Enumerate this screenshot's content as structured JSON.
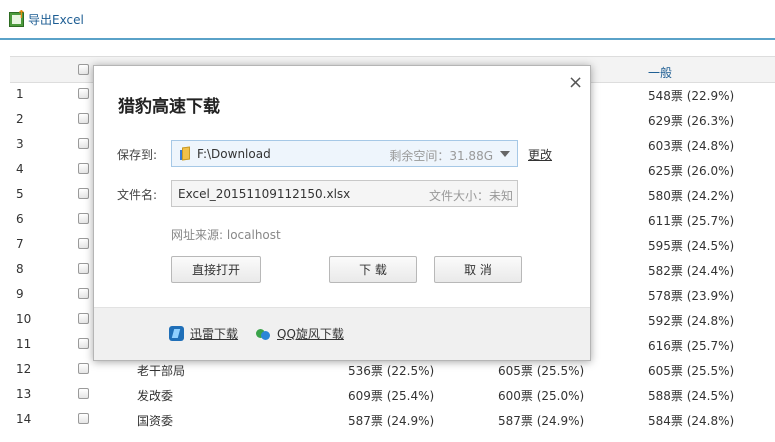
{
  "toolbar": {
    "export_label": "导出Excel"
  },
  "grid": {
    "header_general": "一般",
    "rows": [
      {
        "num": "1",
        "name": "",
        "v1": "",
        "v2": "",
        "v3": "548票 (22.9%)"
      },
      {
        "num": "2",
        "name": "",
        "v1": "",
        "v2": "",
        "v3": "629票 (26.3%)"
      },
      {
        "num": "3",
        "name": "",
        "v1": "",
        "v2": "",
        "v3": "603票 (24.8%)"
      },
      {
        "num": "4",
        "name": "",
        "v1": "",
        "v2": "",
        "v3": "625票 (26.0%)"
      },
      {
        "num": "5",
        "name": "",
        "v1": "",
        "v2": "",
        "v3": "580票 (24.2%)"
      },
      {
        "num": "6",
        "name": "",
        "v1": "",
        "v2": "",
        "v3": "611票 (25.7%)"
      },
      {
        "num": "7",
        "name": "",
        "v1": "",
        "v2": "",
        "v3": "595票 (24.5%)"
      },
      {
        "num": "8",
        "name": "",
        "v1": "",
        "v2": "",
        "v3": "582票 (24.4%)"
      },
      {
        "num": "9",
        "name": "",
        "v1": "",
        "v2": "",
        "v3": "578票 (23.9%)"
      },
      {
        "num": "10",
        "name": "",
        "v1": "",
        "v2": "",
        "v3": "592票 (24.8%)"
      },
      {
        "num": "11",
        "name": "",
        "v1": "",
        "v2": "",
        "v3": "616票 (25.7%)"
      },
      {
        "num": "12",
        "name": "老干部局",
        "v1": "536票 (22.5%)",
        "v2": "605票 (25.5%)",
        "v3": "605票 (25.5%)"
      },
      {
        "num": "13",
        "name": "发改委",
        "v1": "609票 (25.4%)",
        "v2": "600票 (25.0%)",
        "v3": "588票 (24.5%)"
      },
      {
        "num": "14",
        "name": "国资委",
        "v1": "587票 (24.9%)",
        "v2": "587票 (24.9%)",
        "v3": "584票 (24.8%)"
      }
    ]
  },
  "dialog": {
    "title": "猎豹高速下载",
    "close": "×",
    "save_label": "保存到:",
    "path": "F:\\Download",
    "free_space": "剩余空间：31.88G",
    "change": "更改",
    "filename_label": "文件名:",
    "filename": "Excel_20151109112150.xlsx",
    "filesize": "文件大小：未知",
    "source": "网址来源: localhost",
    "btn_open": "直接打开",
    "btn_download": "下 载",
    "btn_cancel": "取 消",
    "alt_xunlei": "迅雷下载",
    "alt_qq": "QQ旋风下载"
  }
}
